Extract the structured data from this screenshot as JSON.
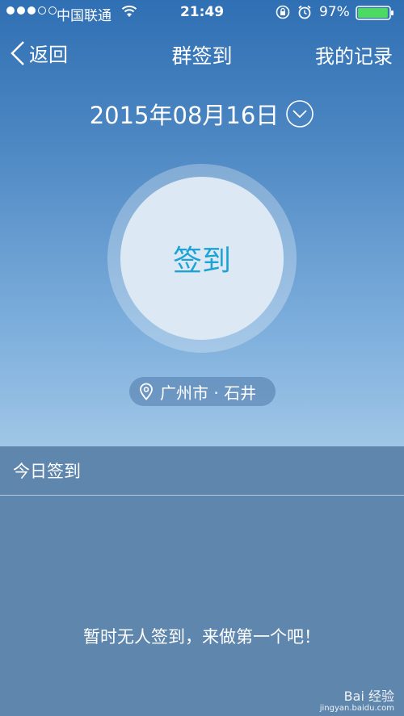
{
  "status_bar": {
    "carrier": "中国联通",
    "time": "21:49",
    "battery_percent": "97%",
    "signal_bars": 3,
    "signal_total": 5,
    "battery_level": 0.97
  },
  "nav": {
    "back_label": "返回",
    "title": "群签到",
    "right_label": "我的记录"
  },
  "date": {
    "text": "2015年08月16日"
  },
  "checkin": {
    "label": "签到"
  },
  "location": {
    "text": "广州市 · 石井"
  },
  "today": {
    "section_title": "今日签到",
    "empty_message": "暂时无人签到，来做第一个吧！"
  },
  "watermark": {
    "brand": "Bai 经验",
    "url": "jingyan.baidu.com"
  },
  "colors": {
    "accent": "#1ca3d3",
    "panel": "#5f86ad",
    "circle": "#dce9f4"
  },
  "icons": [
    "wifi-icon",
    "lock-rotation-icon",
    "alarm-icon",
    "battery-icon",
    "back-chevron-icon",
    "chevron-down-icon",
    "location-pin-icon"
  ]
}
